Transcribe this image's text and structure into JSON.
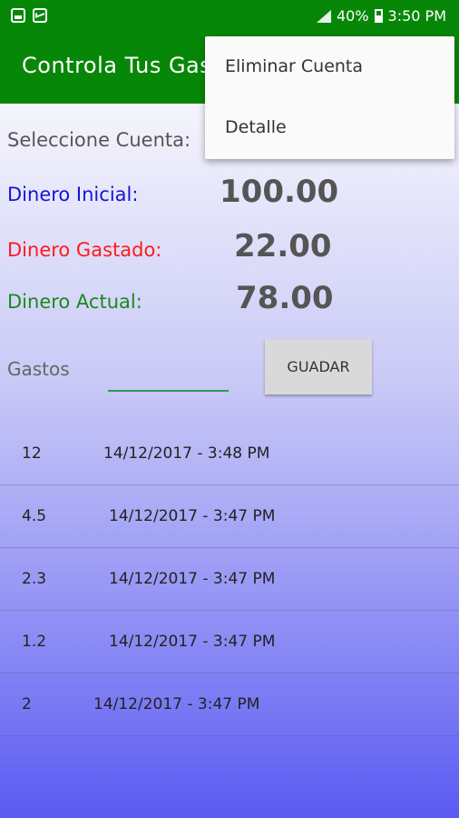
{
  "status_bar": {
    "battery": "40%",
    "time": "3:50 PM",
    "icons": [
      "image-icon",
      "mail-icon",
      "signal-icon",
      "battery-icon"
    ]
  },
  "toolbar": {
    "title": "Controla Tus Gastos"
  },
  "menu": {
    "items": [
      "Eliminar Cuenta",
      "Detalle"
    ]
  },
  "account": {
    "select_label": "Seleccione Cuenta:"
  },
  "money": {
    "inicial_label": "Dinero Inicial:",
    "inicial_value": "100.00",
    "gastado_label": "Dinero Gastado:",
    "gastado_value": "22.00",
    "actual_label": "Dinero Actual:",
    "actual_value": "78.00"
  },
  "gastos": {
    "label": "Gastos",
    "input_value": "",
    "save_label": "GUADAR"
  },
  "expenses": [
    {
      "amount": "12",
      "date": "14/12/2017 - 3:48 PM"
    },
    {
      "amount": "4.5",
      "date": "14/12/2017 - 3:47 PM"
    },
    {
      "amount": "2.3",
      "date": "14/12/2017 - 3:47 PM"
    },
    {
      "amount": "1.2",
      "date": "14/12/2017 - 3:47 PM"
    },
    {
      "amount": "2",
      "date": "14/12/2017 - 3:47 PM"
    }
  ],
  "colors": {
    "primary": "#078707",
    "inicial": "#1414d8",
    "gastado": "#ff1a1a",
    "actual": "#1a8a1a",
    "input_underline": "#2e9a52"
  }
}
